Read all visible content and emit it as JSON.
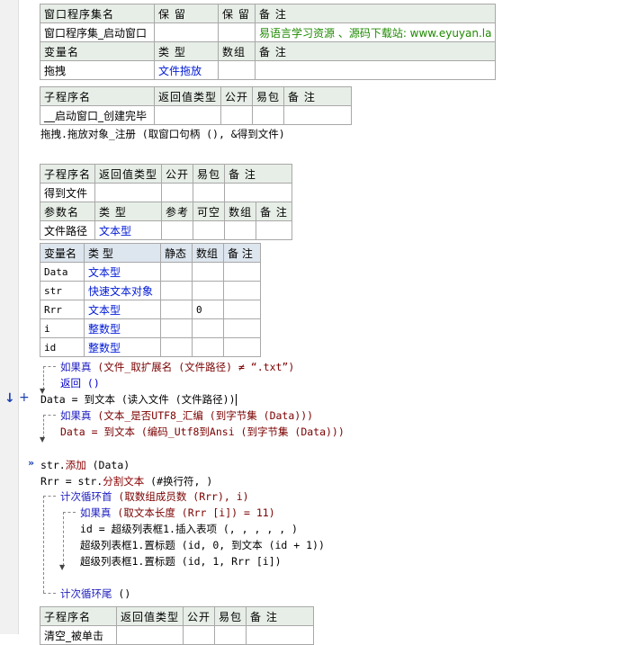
{
  "program_set_table": {
    "headers": [
      "窗口程序集名",
      "保 留",
      "保 留",
      "备 注"
    ],
    "row": [
      "窗口程序集_启动窗口",
      "",
      "",
      "易语言学习资源 、源码下载站: www.eyuyan.la"
    ],
    "var_headers": [
      "变量名",
      "类 型",
      "数组",
      "备 注"
    ],
    "var_row": [
      "拖拽",
      "文件拖放",
      "",
      ""
    ]
  },
  "sub1_table": {
    "headers": [
      "子程序名",
      "返回值类型",
      "公开",
      "易包",
      "备 注"
    ],
    "row": [
      "__启动窗口_创建完毕",
      "",
      "",
      "",
      ""
    ]
  },
  "sub1_code": "拖拽.拖放对象_注册 (取窗口句柄 (), &得到文件)",
  "sub2_table": {
    "headers": [
      "子程序名",
      "返回值类型",
      "公开",
      "易包",
      "备 注"
    ],
    "row": [
      "得到文件",
      "",
      "",
      "",
      ""
    ],
    "param_headers": [
      "参数名",
      "类 型",
      "参考",
      "可空",
      "数组",
      "备 注"
    ],
    "param_row": [
      "文件路径",
      "文本型",
      "",
      "",
      "",
      ""
    ]
  },
  "local_vars": {
    "headers": [
      "变量名",
      "类 型",
      "静态",
      "数组",
      "备 注"
    ],
    "rows": [
      [
        "Data",
        "文本型",
        "",
        "",
        ""
      ],
      [
        "str",
        "快速文本对象",
        "",
        "",
        ""
      ],
      [
        "Rrr",
        "文本型",
        "",
        "0",
        ""
      ],
      [
        "i",
        "整数型",
        "",
        "",
        ""
      ],
      [
        "id",
        "整数型",
        "",
        "",
        ""
      ]
    ]
  },
  "code": {
    "l1_kw": "如果真",
    "l1_rest": " (文件_取扩展名 (文件路径) ≠ “.txt”)",
    "l2": "返回 ()",
    "l3": "Data = 到文本 (读入文件 (文件路径))",
    "l4_kw": "如果真",
    "l4_rest": " (文本_是否UTF8_汇编 (到字节集 (Data)))",
    "l5": "Data = 到文本 (编码_Utf8到Ansi (到字节集 (Data)))",
    "l6a": "str.",
    "l6b": "添加",
    "l6c": " (Data)",
    "l7a": "Rrr = str.",
    "l7b": "分割文本",
    "l7c": " (#换行符, )",
    "l8_kw": "计次循环首",
    "l8_rest": " (取数组成员数 (Rrr), i)",
    "l9_kw": "如果真",
    "l9_rest": " (取文本长度 (Rrr [i]) = 11)",
    "l10": "id = 超级列表框1.插入表项 (, , , , , )",
    "l11": "超级列表框1.置标题 (id, 0, 到文本 (id + 1))",
    "l12": "超级列表框1.置标题 (id, 1, Rrr [i])",
    "l13_kw": "计次循环尾",
    "l13_rest": " ()"
  },
  "gutter_marks": {
    "arrow": "↓",
    "plus": "+",
    "bookmark": "»"
  },
  "sub3_table": {
    "headers": [
      "子程序名",
      "返回值类型",
      "公开",
      "易包",
      "备 注"
    ],
    "row": [
      "清空_被单击",
      "",
      "",
      "",
      ""
    ]
  }
}
